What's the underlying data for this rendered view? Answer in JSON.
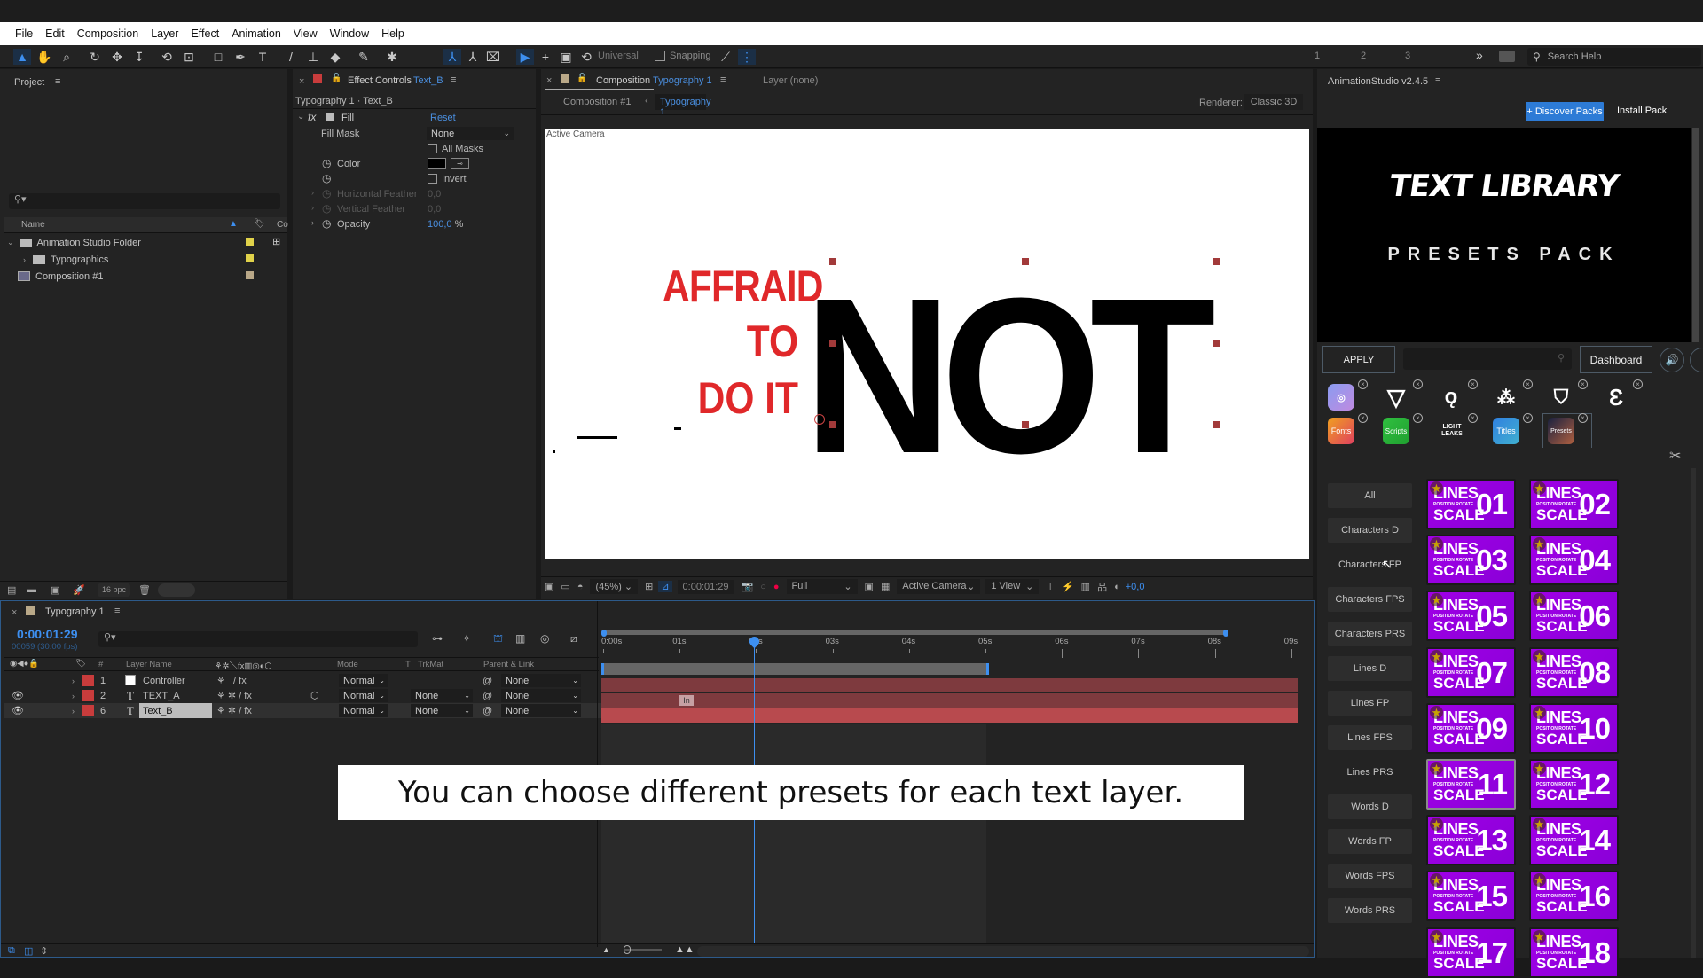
{
  "menu": [
    "File",
    "Edit",
    "Composition",
    "Layer",
    "Effect",
    "Animation",
    "View",
    "Window",
    "Help"
  ],
  "toolbar": {
    "axis_mode": "Universal",
    "snapping": "Snapping",
    "workspaces": [
      "1",
      "2",
      "3"
    ],
    "more": "»",
    "search_placeholder": "Search Help"
  },
  "project": {
    "title": "Project",
    "search_placeholder": "",
    "col_name": "Name",
    "items": [
      {
        "name": "Animation Studio Folder",
        "type": "folder",
        "expanded": true,
        "label_color": "#e0d24a"
      },
      {
        "name": "Typographics",
        "type": "folder",
        "expanded": false,
        "label_color": "#e0d24a"
      },
      {
        "name": "Composition #1",
        "type": "composition",
        "label_color": "#b9a888"
      }
    ],
    "bpc": "16 bpc"
  },
  "effect_controls": {
    "tab_label": "Effect Controls",
    "tab_layer": "Text_B",
    "path": "Typography 1 · Text_B",
    "effect_name": "Fill",
    "reset": "Reset",
    "fill_mask_label": "Fill Mask",
    "fill_mask_value": "None",
    "all_masks": "All Masks",
    "color_label": "Color",
    "color_value": "#000000",
    "invert": "Invert",
    "h_feather_label": "Horizontal Feather",
    "h_feather_value": "0,0",
    "v_feather_label": "Vertical Feather",
    "v_feather_value": "0,0",
    "opacity_label": "Opacity",
    "opacity_value": "100,0",
    "opacity_unit": "%"
  },
  "composition": {
    "tab_prefix": "Composition",
    "tab_name": "Typography 1",
    "layer_tab": "Layer (none)",
    "breadcrumb_parent": "Composition #1",
    "breadcrumb_current": "Typography 1",
    "renderer_label": "Renderer:",
    "renderer_value": "Classic 3D",
    "view_label": "Active Camera",
    "canvas_text": {
      "line1": "AFFRAID",
      "line2": "TO",
      "line3": "DO IT",
      "big": "NOT"
    },
    "footer": {
      "zoom": "(45%)",
      "timecode": "0:00:01:29",
      "resolution": "Full",
      "camera": "Active Camera",
      "views": "1 View",
      "exposure": "+0,0"
    }
  },
  "timeline": {
    "tab": "Typography 1",
    "timecode": "0:00:01:29",
    "frame_info": "00059 (30.00 fps)",
    "search_placeholder": "",
    "columns": {
      "num": "#",
      "layer_name": "Layer Name",
      "mode": "Mode",
      "t": "T",
      "trkmat": "TrkMat",
      "parent": "Parent & Link"
    },
    "layers": [
      {
        "num": "1",
        "name": "Controller",
        "type": "solid",
        "mode": "Normal",
        "trkmat": "",
        "parent": "None",
        "visible": false
      },
      {
        "num": "2",
        "name": "TEXT_A",
        "type": "text",
        "mode": "Normal",
        "trkmat": "None",
        "parent": "None",
        "visible": true
      },
      {
        "num": "6",
        "name": "Text_B",
        "type": "text",
        "mode": "Normal",
        "trkmat": "None",
        "parent": "None",
        "visible": true,
        "selected": true
      }
    ],
    "ruler": [
      "0:00s",
      "01s",
      "02s",
      "03s",
      "04s",
      "05s",
      "06s",
      "07s",
      "08s",
      "09s"
    ],
    "marker_label": "In",
    "current_time_seconds": 1.97,
    "work_area_end_seconds": 5.05
  },
  "caption": "You can choose different presets for each text layer.",
  "animation_studio": {
    "title": "AnimationStudio v2.4.5",
    "discover": "+ Discover Packs",
    "install": "Install Pack",
    "banner_title": "TEXT LIBRARY",
    "banner_subtitle": "PRESETS PACK",
    "apply": "APPLY",
    "search_placeholder": "",
    "dashboard": "Dashboard",
    "plugins_row1": [
      "instagram",
      "v-logo",
      "o-logo",
      "diamond-dots",
      "shield-stripes",
      "e-logo"
    ],
    "plugins_row2": [
      "Fonts",
      "Scripts",
      "LIGHT LEAKS",
      "Titles",
      "Presets"
    ],
    "categories": [
      "All",
      "Characters D",
      "Characters FP",
      "Characters FPS",
      "Characters PRS",
      "Lines D",
      "Lines FP",
      "Lines FPS",
      "Lines PRS",
      "Words D",
      "Words FP",
      "Words FPS",
      "Words PRS"
    ],
    "preset_tile": {
      "line1": "LINES",
      "line2": "POSITION ROTATE",
      "line3": "SCALE"
    },
    "presets": [
      "01",
      "02",
      "03",
      "04",
      "05",
      "06",
      "07",
      "08",
      "09",
      "10",
      "11",
      "12",
      "13",
      "14",
      "15",
      "16",
      "17",
      "18"
    ],
    "selected_preset": "11"
  }
}
